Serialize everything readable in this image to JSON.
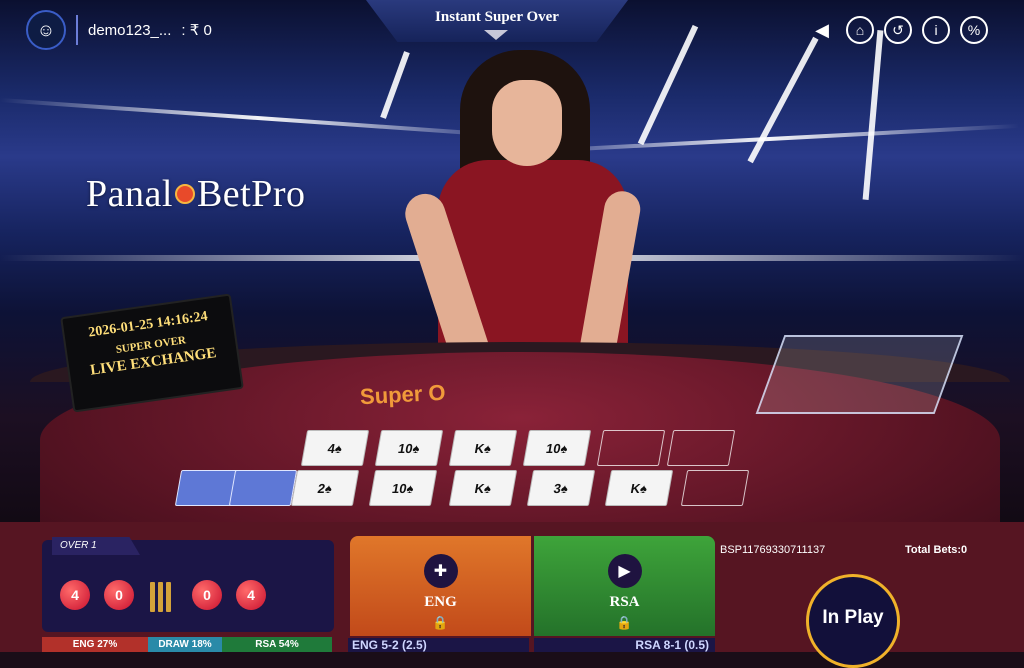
{
  "header": {
    "username": "demo123_...",
    "balance_sep": ": ₹ 0",
    "title": "Instant Super Over",
    "icons": [
      "sound-icon",
      "home-icon",
      "history-icon",
      "info-icon",
      "odds-icon"
    ]
  },
  "studio": {
    "brand_left": "Panal",
    "brand_right": "BetPro",
    "clock_datetime": "2026-01-25 14:16:24",
    "clock_title": "SUPER OVER",
    "clock_subtitle": "LIVE EXCHANGE",
    "table_logo": "Super O"
  },
  "cards": {
    "row1": [
      "4♠",
      "10♠",
      "K♠",
      "10♠",
      "",
      ""
    ],
    "row2": [
      "2♠",
      "10♠",
      "K♠",
      "3♠",
      "K♠",
      ""
    ]
  },
  "over": {
    "label": "OVER 1",
    "balls": [
      "4",
      "0",
      "wicket",
      "0",
      "4"
    ]
  },
  "odds": [
    {
      "label": "ENG 27%",
      "color": "#b2312a"
    },
    {
      "label": "DRAW 18%",
      "color": "#2a8aa8"
    },
    {
      "label": "RSA 54%",
      "color": "#1f7a3a"
    }
  ],
  "teams": [
    {
      "name": "ENG",
      "score": "ENG 5-2 (2.5)",
      "color": "#e0772a"
    },
    {
      "name": "RSA",
      "score": "RSA 8-1 (0.5)",
      "color": "#3ea43a"
    }
  ],
  "bet": {
    "round_id": "BSP11769330711137",
    "total_bets": "Total Bets:0",
    "status": "In Play"
  }
}
